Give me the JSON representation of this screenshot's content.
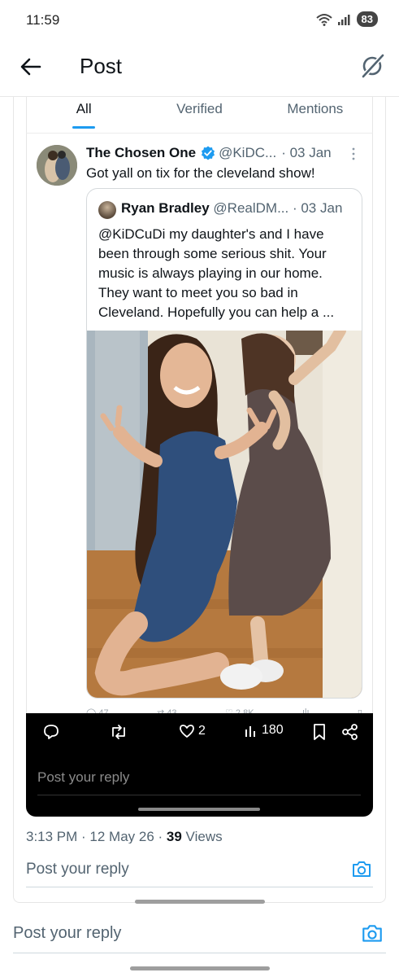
{
  "status_bar": {
    "time": "11:59",
    "battery": "83"
  },
  "header": {
    "title": "Post"
  },
  "tabs": [
    {
      "label": "All",
      "active": true
    },
    {
      "label": "Verified",
      "active": false
    },
    {
      "label": "Mentions",
      "active": false
    }
  ],
  "tweet": {
    "author_name": "The Chosen One",
    "handle": "@KiDC...",
    "date": "· 03 Jan",
    "text": "Got yall on tix for the cleveland show!",
    "quoted": {
      "author_name": "Ryan Bradley",
      "handle": "@RealDM...",
      "date": "· 03 Jan",
      "text": "@KiDCuDi my daughter's and I have been through some serious shit. Your music is always playing in our home. They want to meet you so bad in Cleveland. Hopefully you can help a ..."
    },
    "faded_metrics": {
      "replies": "47",
      "reposts": "43",
      "likes": "2.8K"
    }
  },
  "reply_sheet": {
    "likes": "2",
    "views": "180",
    "reply_placeholder": "Post your reply"
  },
  "timestamp": {
    "time": "3:13 PM · 12 May 26 · ",
    "views_count": "39",
    "views_label": " Views"
  },
  "reply_bar_inner": {
    "placeholder": "Post your reply"
  },
  "reply_bar_outer": {
    "placeholder": "Post your reply"
  },
  "colors": {
    "accent": "#1d9bf0",
    "text": "#0f1419",
    "muted": "#536471",
    "sheet_bg": "#000000"
  }
}
